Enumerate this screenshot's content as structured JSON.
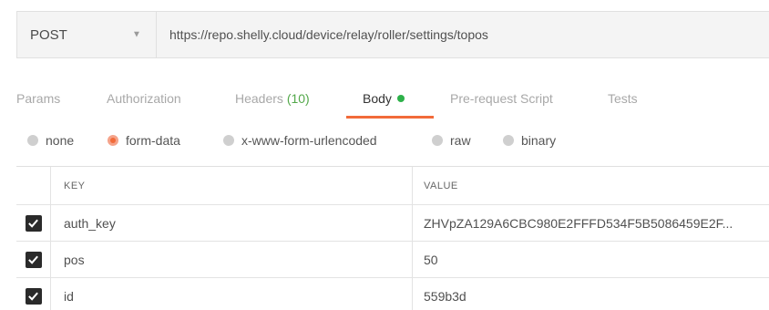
{
  "request": {
    "method": "POST",
    "url": "https://repo.shelly.cloud/device/relay/roller/settings/topos"
  },
  "tabs": [
    {
      "label": "Params"
    },
    {
      "label": "Authorization"
    },
    {
      "label": "Headers",
      "count": "(10)"
    },
    {
      "label": "Body",
      "active": true
    },
    {
      "label": "Pre-request Script"
    },
    {
      "label": "Tests"
    }
  ],
  "body_types": [
    {
      "label": "none"
    },
    {
      "label": "form-data",
      "selected": true
    },
    {
      "label": "x-www-form-urlencoded"
    },
    {
      "label": "raw"
    },
    {
      "label": "binary"
    }
  ],
  "table": {
    "headers": {
      "key": "KEY",
      "value": "VALUE"
    },
    "rows": [
      {
        "key": "auth_key",
        "value": "ZHVpZA129A6CBC980E2FFFD534F5B5086459E2F...",
        "checked": true
      },
      {
        "key": "pos",
        "value": "50",
        "checked": true
      },
      {
        "key": "id",
        "value": "559b3d",
        "checked": true
      }
    ]
  },
  "colors": {
    "accent": "#f26b3a",
    "active_dot": "#2db14a",
    "count": "#53a84a"
  }
}
